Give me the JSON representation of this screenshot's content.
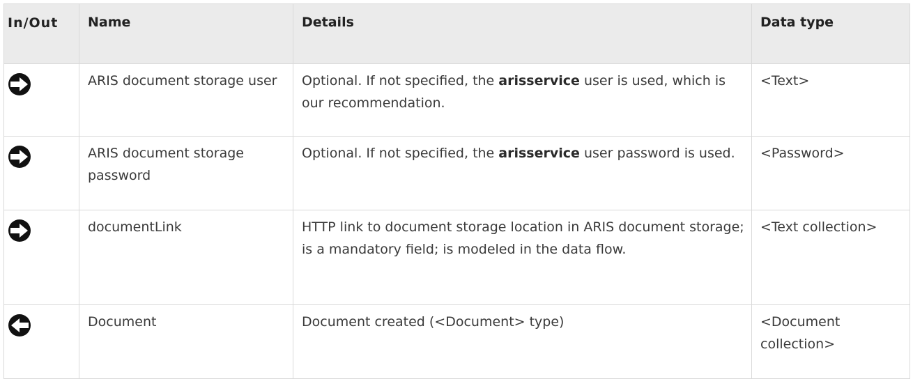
{
  "table": {
    "headers": {
      "io": "In/Out",
      "name": "Name",
      "details": "Details",
      "type": "Data type"
    },
    "rows": [
      {
        "direction": "in",
        "direction_icon": "arrow-right-icon",
        "name": "ARIS document storage user",
        "details_before": "Optional. If not specified, the ",
        "details_bold": "arisservice",
        "details_after": " user is used, which is our recommendation.",
        "data_type": "<Text>"
      },
      {
        "direction": "in",
        "direction_icon": "arrow-right-icon",
        "name": "ARIS document storage password",
        "details_before": "Optional. If not specified, the ",
        "details_bold": "arisservice",
        "details_after": " user password is used.",
        "data_type": "<Password>"
      },
      {
        "direction": "in",
        "direction_icon": "arrow-right-icon",
        "name": "documentLink",
        "details_before": "HTTP link to document storage location in ARIS document storage; is a mandatory field; is modeled in the data flow.",
        "details_bold": "",
        "details_after": "",
        "data_type": "<Text collection>"
      },
      {
        "direction": "out",
        "direction_icon": "arrow-left-icon",
        "name": "Document",
        "details_before": "Document created (<Document> type)",
        "details_bold": "",
        "details_after": "",
        "data_type": "<Document collection>"
      }
    ]
  }
}
